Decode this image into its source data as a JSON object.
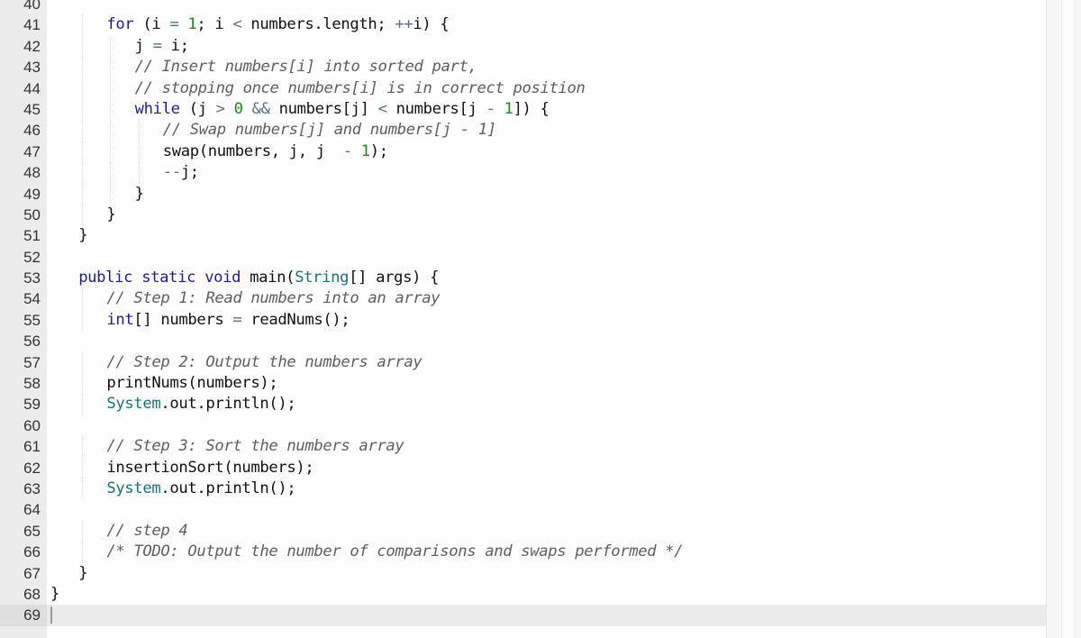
{
  "editor": {
    "language": "java",
    "current_line": 69,
    "lines": [
      {
        "n": "40",
        "indent": 0,
        "guides": [],
        "tokens": []
      },
      {
        "n": "41",
        "indent": 2,
        "guides": [
          1
        ],
        "tokens": [
          {
            "t": "for",
            "c": "kw"
          },
          {
            "t": " (i "
          },
          {
            "t": "=",
            "c": "op"
          },
          {
            "t": " "
          },
          {
            "t": "1",
            "c": "num"
          },
          {
            "t": "; i "
          },
          {
            "t": "<",
            "c": "op"
          },
          {
            "t": " numbers.length; "
          },
          {
            "t": "++",
            "c": "op"
          },
          {
            "t": "i) {"
          }
        ]
      },
      {
        "n": "42",
        "indent": 3,
        "guides": [
          1,
          2
        ],
        "tokens": [
          {
            "t": "j "
          },
          {
            "t": "=",
            "c": "op"
          },
          {
            "t": " i;"
          }
        ]
      },
      {
        "n": "43",
        "indent": 3,
        "guides": [
          1,
          2
        ],
        "tokens": [
          {
            "t": "// Insert numbers[i] into sorted part,",
            "c": "cm"
          }
        ]
      },
      {
        "n": "44",
        "indent": 3,
        "guides": [
          1,
          2
        ],
        "tokens": [
          {
            "t": "// stopping once numbers[i] is in correct position",
            "c": "cm"
          }
        ]
      },
      {
        "n": "45",
        "indent": 3,
        "guides": [
          1,
          2
        ],
        "tokens": [
          {
            "t": "while",
            "c": "kw"
          },
          {
            "t": " (j "
          },
          {
            "t": ">",
            "c": "op"
          },
          {
            "t": " "
          },
          {
            "t": "0",
            "c": "num"
          },
          {
            "t": " "
          },
          {
            "t": "&&",
            "c": "op"
          },
          {
            "t": " numbers[j] "
          },
          {
            "t": "<",
            "c": "op"
          },
          {
            "t": " numbers[j "
          },
          {
            "t": "-",
            "c": "op"
          },
          {
            "t": " "
          },
          {
            "t": "1",
            "c": "num"
          },
          {
            "t": "]) {"
          }
        ]
      },
      {
        "n": "46",
        "indent": 4,
        "guides": [
          1,
          2,
          3
        ],
        "tokens": [
          {
            "t": "// Swap numbers[j] and numbers[j - 1]",
            "c": "cm"
          }
        ]
      },
      {
        "n": "47",
        "indent": 4,
        "guides": [
          1,
          2,
          3
        ],
        "tokens": [
          {
            "t": "swap(numbers, j, j  "
          },
          {
            "t": "-",
            "c": "op"
          },
          {
            "t": " "
          },
          {
            "t": "1",
            "c": "num"
          },
          {
            "t": ");"
          }
        ]
      },
      {
        "n": "48",
        "indent": 4,
        "guides": [
          1,
          2,
          3
        ],
        "tokens": [
          {
            "t": "--",
            "c": "op"
          },
          {
            "t": "j;"
          }
        ]
      },
      {
        "n": "49",
        "indent": 3,
        "guides": [
          1,
          2
        ],
        "tokens": [
          {
            "t": "}"
          }
        ]
      },
      {
        "n": "50",
        "indent": 2,
        "guides": [
          1
        ],
        "tokens": [
          {
            "t": "}"
          }
        ]
      },
      {
        "n": "51",
        "indent": 1,
        "guides": [],
        "tokens": [
          {
            "t": "}"
          }
        ]
      },
      {
        "n": "52",
        "indent": 0,
        "guides": [],
        "tokens": []
      },
      {
        "n": "53",
        "indent": 1,
        "guides": [],
        "tokens": [
          {
            "t": "public",
            "c": "kw"
          },
          {
            "t": " "
          },
          {
            "t": "static",
            "c": "kw"
          },
          {
            "t": " "
          },
          {
            "t": "void",
            "c": "kw"
          },
          {
            "t": " main("
          },
          {
            "t": "String",
            "c": "type"
          },
          {
            "t": "[] args) {"
          }
        ]
      },
      {
        "n": "54",
        "indent": 2,
        "guides": [
          1
        ],
        "tokens": [
          {
            "t": "// Step 1: Read numbers into an array",
            "c": "cm"
          }
        ]
      },
      {
        "n": "55",
        "indent": 2,
        "guides": [
          1
        ],
        "tokens": [
          {
            "t": "int",
            "c": "kw"
          },
          {
            "t": "[] numbers "
          },
          {
            "t": "=",
            "c": "op"
          },
          {
            "t": " readNums();"
          }
        ]
      },
      {
        "n": "56",
        "indent": 0,
        "guides": [],
        "tokens": []
      },
      {
        "n": "57",
        "indent": 2,
        "guides": [
          1
        ],
        "tokens": [
          {
            "t": "// Step 2: Output the numbers array",
            "c": "cm"
          }
        ]
      },
      {
        "n": "58",
        "indent": 2,
        "guides": [
          1
        ],
        "tokens": [
          {
            "t": "printNums(numbers);"
          }
        ]
      },
      {
        "n": "59",
        "indent": 2,
        "guides": [
          1
        ],
        "tokens": [
          {
            "t": "System",
            "c": "type"
          },
          {
            "t": ".out.println();"
          }
        ]
      },
      {
        "n": "60",
        "indent": 0,
        "guides": [],
        "tokens": []
      },
      {
        "n": "61",
        "indent": 2,
        "guides": [
          1
        ],
        "tokens": [
          {
            "t": "// Step 3: Sort the numbers array",
            "c": "cm"
          }
        ]
      },
      {
        "n": "62",
        "indent": 2,
        "guides": [
          1
        ],
        "tokens": [
          {
            "t": "insertionSort(numbers);"
          }
        ]
      },
      {
        "n": "63",
        "indent": 2,
        "guides": [
          1
        ],
        "tokens": [
          {
            "t": "System",
            "c": "type"
          },
          {
            "t": ".out.println();"
          }
        ]
      },
      {
        "n": "64",
        "indent": 0,
        "guides": [],
        "tokens": []
      },
      {
        "n": "65",
        "indent": 2,
        "guides": [
          1
        ],
        "tokens": [
          {
            "t": "// step 4",
            "c": "cm"
          }
        ]
      },
      {
        "n": "66",
        "indent": 2,
        "guides": [
          1
        ],
        "tokens": [
          {
            "t": "/* TODO: Output the number of comparisons and swaps performed */",
            "c": "cm"
          }
        ]
      },
      {
        "n": "67",
        "indent": 1,
        "guides": [],
        "tokens": [
          {
            "t": "}"
          }
        ]
      },
      {
        "n": "68",
        "indent": 0,
        "guides": [],
        "tokens": [
          {
            "t": "}"
          }
        ]
      },
      {
        "n": "69",
        "indent": 0,
        "guides": [],
        "tokens": [],
        "cursor": true
      }
    ]
  },
  "colors": {
    "keyword": "#1a1aa6",
    "number": "#1b8a1b",
    "operator": "#5a6e8c",
    "type": "#1a7373",
    "comment": "#5e5e5e"
  }
}
